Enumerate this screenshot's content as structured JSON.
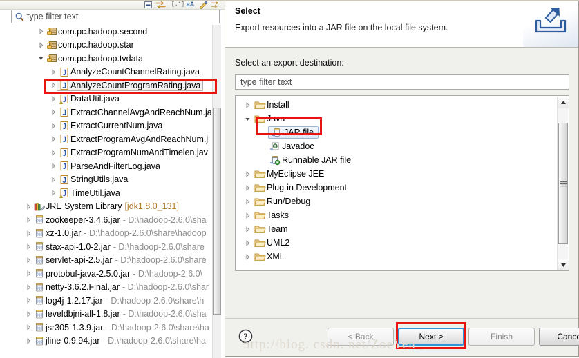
{
  "explorer": {
    "toolbar": {
      "icons": [
        {
          "name": "collapse-all-icon",
          "glyph": "⊟"
        },
        {
          "name": "link-with-editor-icon",
          "glyph": "⇨"
        },
        {
          "name": "regex-filter-icon",
          "glyph": "[.*]"
        },
        {
          "name": "case-sensitive-icon",
          "glyph": "aA"
        },
        {
          "name": "focus-icon",
          "glyph": "✎"
        },
        {
          "name": "sort-icon",
          "glyph": "⇲"
        }
      ]
    },
    "filter": {
      "placeholder": "type filter text",
      "value": ""
    },
    "tree": [
      {
        "indent": 2,
        "arrow": "collapsed",
        "icon": "package-icon",
        "label": "com.pc.hadoop.second",
        "path": ""
      },
      {
        "indent": 2,
        "arrow": "collapsed",
        "icon": "package-icon",
        "label": "com.pc.hadoop.star",
        "path": ""
      },
      {
        "indent": 2,
        "arrow": "expanded",
        "icon": "package-icon",
        "label": "com.pc.hadoop.tvdata",
        "path": ""
      },
      {
        "indent": 3,
        "arrow": "collapsed",
        "icon": "java-file-icon",
        "label": "AnalyzeCountChannelRating.java",
        "path": ""
      },
      {
        "indent": 3,
        "arrow": "collapsed",
        "icon": "java-file-icon",
        "label": "AnalyzeCountProgramRating.java",
        "path": "",
        "selected": true
      },
      {
        "indent": 3,
        "arrow": "collapsed",
        "icon": "java-file-warning-icon",
        "label": "DataUtil.java",
        "path": ""
      },
      {
        "indent": 3,
        "arrow": "collapsed",
        "icon": "java-file-icon",
        "label": "ExtractChannelAvgAndReachNum.ja",
        "path": ""
      },
      {
        "indent": 3,
        "arrow": "collapsed",
        "icon": "java-file-icon",
        "label": "ExtractCurrentNum.java",
        "path": ""
      },
      {
        "indent": 3,
        "arrow": "collapsed",
        "icon": "java-file-icon",
        "label": "ExtractProgramAvgAndReachNum.j",
        "path": ""
      },
      {
        "indent": 3,
        "arrow": "collapsed",
        "icon": "java-file-icon",
        "label": "ExtractProgramNumAndTimelen.jav",
        "path": ""
      },
      {
        "indent": 3,
        "arrow": "collapsed",
        "icon": "java-file-icon",
        "label": "ParseAndFilterLog.java",
        "path": ""
      },
      {
        "indent": 3,
        "arrow": "collapsed",
        "icon": "java-file-icon",
        "label": "StringUtils.java",
        "path": ""
      },
      {
        "indent": 3,
        "arrow": "collapsed",
        "icon": "java-file-warning-icon",
        "label": "TimeUtil.java",
        "path": ""
      },
      {
        "indent": 1,
        "arrow": "collapsed",
        "icon": "jre-library-icon",
        "label": "JRE System Library",
        "path": "[jdk1.8.0_131]",
        "pathStyle": "jre"
      },
      {
        "indent": 1,
        "arrow": "collapsed",
        "icon": "jar-icon",
        "label": "zookeeper-3.4.6.jar",
        "path": "- D:\\hadoop-2.6.0\\sha"
      },
      {
        "indent": 1,
        "arrow": "collapsed",
        "icon": "jar-icon",
        "label": "xz-1.0.jar",
        "path": "- D:\\hadoop-2.6.0\\share\\hadoop"
      },
      {
        "indent": 1,
        "arrow": "collapsed",
        "icon": "jar-icon",
        "label": "stax-api-1.0-2.jar",
        "path": "- D:\\hadoop-2.6.0\\share"
      },
      {
        "indent": 1,
        "arrow": "collapsed",
        "icon": "jar-icon",
        "label": "servlet-api-2.5.jar",
        "path": "- D:\\hadoop-2.6.0\\share"
      },
      {
        "indent": 1,
        "arrow": "collapsed",
        "icon": "jar-icon",
        "label": "protobuf-java-2.5.0.jar",
        "path": "- D:\\hadoop-2.6.0\\"
      },
      {
        "indent": 1,
        "arrow": "collapsed",
        "icon": "jar-icon",
        "label": "netty-3.6.2.Final.jar",
        "path": "- D:\\hadoop-2.6.0\\shar"
      },
      {
        "indent": 1,
        "arrow": "collapsed",
        "icon": "jar-icon",
        "label": "log4j-1.2.17.jar",
        "path": "- D:\\hadoop-2.6.0\\share\\h"
      },
      {
        "indent": 1,
        "arrow": "collapsed",
        "icon": "jar-icon",
        "label": "leveldbjni-all-1.8.jar",
        "path": "- D:\\hadoop-2.6.0\\sha"
      },
      {
        "indent": 1,
        "arrow": "collapsed",
        "icon": "jar-icon",
        "label": "jsr305-1.3.9.jar",
        "path": "- D:\\hadoop-2.6.0\\share\\ha"
      },
      {
        "indent": 1,
        "arrow": "collapsed",
        "icon": "jar-icon",
        "label": "jline-0.9.94.jar",
        "path": "- D:\\hadoop-2.6.0\\share\\ha"
      }
    ]
  },
  "dialog": {
    "title": "Select",
    "description": "Export resources into a JAR file on the local file system.",
    "banner_icon": "export-arrow-icon",
    "destination_label": "Select an export destination:",
    "filter": {
      "placeholder": "type filter text",
      "value": ""
    },
    "tree": [
      {
        "indent": 0,
        "arrow": "collapsed",
        "icon": "folder-icon",
        "label": "Install"
      },
      {
        "indent": 0,
        "arrow": "expanded",
        "icon": "folder-icon",
        "label": "Java"
      },
      {
        "indent": 1,
        "arrow": "none",
        "icon": "jar-file-icon",
        "label": "JAR file",
        "selected": true
      },
      {
        "indent": 1,
        "arrow": "none",
        "icon": "javadoc-icon",
        "label": "Javadoc"
      },
      {
        "indent": 1,
        "arrow": "none",
        "icon": "runnable-jar-icon",
        "label": "Runnable JAR file"
      },
      {
        "indent": 0,
        "arrow": "collapsed",
        "icon": "folder-icon",
        "label": "MyEclipse JEE"
      },
      {
        "indent": 0,
        "arrow": "collapsed",
        "icon": "folder-icon",
        "label": "Plug-in Development"
      },
      {
        "indent": 0,
        "arrow": "collapsed",
        "icon": "folder-icon",
        "label": "Run/Debug"
      },
      {
        "indent": 0,
        "arrow": "collapsed",
        "icon": "folder-icon",
        "label": "Tasks"
      },
      {
        "indent": 0,
        "arrow": "collapsed",
        "icon": "folder-icon",
        "label": "Team"
      },
      {
        "indent": 0,
        "arrow": "collapsed",
        "icon": "folder-icon",
        "label": "UML2"
      },
      {
        "indent": 0,
        "arrow": "collapsed",
        "icon": "folder-icon",
        "label": "XML"
      }
    ],
    "buttons": {
      "help": "?",
      "back": "< Back",
      "next": "Next >",
      "finish": "Finish",
      "cancel": "Cancel"
    }
  },
  "annotations": {
    "highlight_color": "#e8140f",
    "highlighted": [
      "AnalyzeCountProgramRating.java",
      "JAR file",
      "Next >"
    ]
  },
  "watermark": "http://blog. csdn. net/ZoeYen_"
}
